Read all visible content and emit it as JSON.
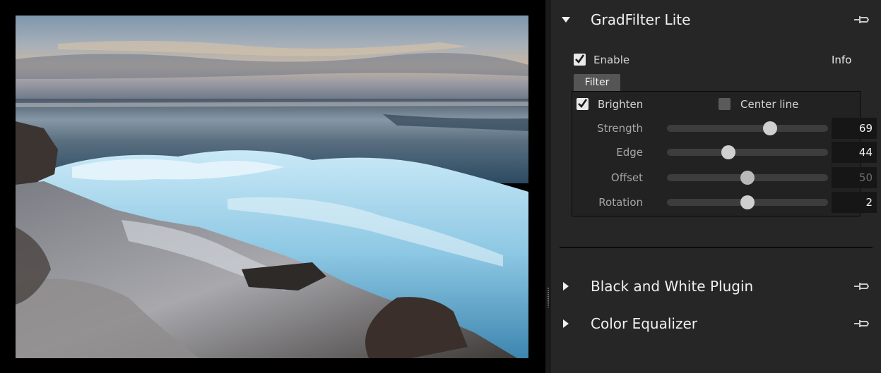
{
  "preview": {
    "image_description": "photo"
  },
  "panels": [
    {
      "title": "GradFilter Lite",
      "expanded": true,
      "enable_label": "Enable",
      "enable_checked": true,
      "info_link": "Info",
      "tab_label": "Filter",
      "brighten_label": "Brighten",
      "brighten_checked": true,
      "center_line_label": "Center line",
      "center_line_checked": false,
      "sliders": [
        {
          "label": "Strength",
          "value": "69",
          "fraction": 0.64,
          "enabled": true
        },
        {
          "label": "Edge",
          "value": "44",
          "fraction": 0.38,
          "enabled": true
        },
        {
          "label": "Offset",
          "value": "50",
          "fraction": 0.5,
          "enabled": false
        },
        {
          "label": "Rotation",
          "value": "2",
          "fraction": 0.5,
          "enabled": true
        }
      ]
    },
    {
      "title": "Black and White Plugin",
      "expanded": false
    },
    {
      "title": "Color Equalizer",
      "expanded": false
    }
  ],
  "icons": {
    "expanded": "triangle-down-icon",
    "collapsed": "triangle-right-icon",
    "pin": "pin-icon"
  },
  "colors": {
    "panel_bg": "#262626",
    "slider_track": "#3d3d3d",
    "slider_thumb": "#cfcfcf"
  }
}
